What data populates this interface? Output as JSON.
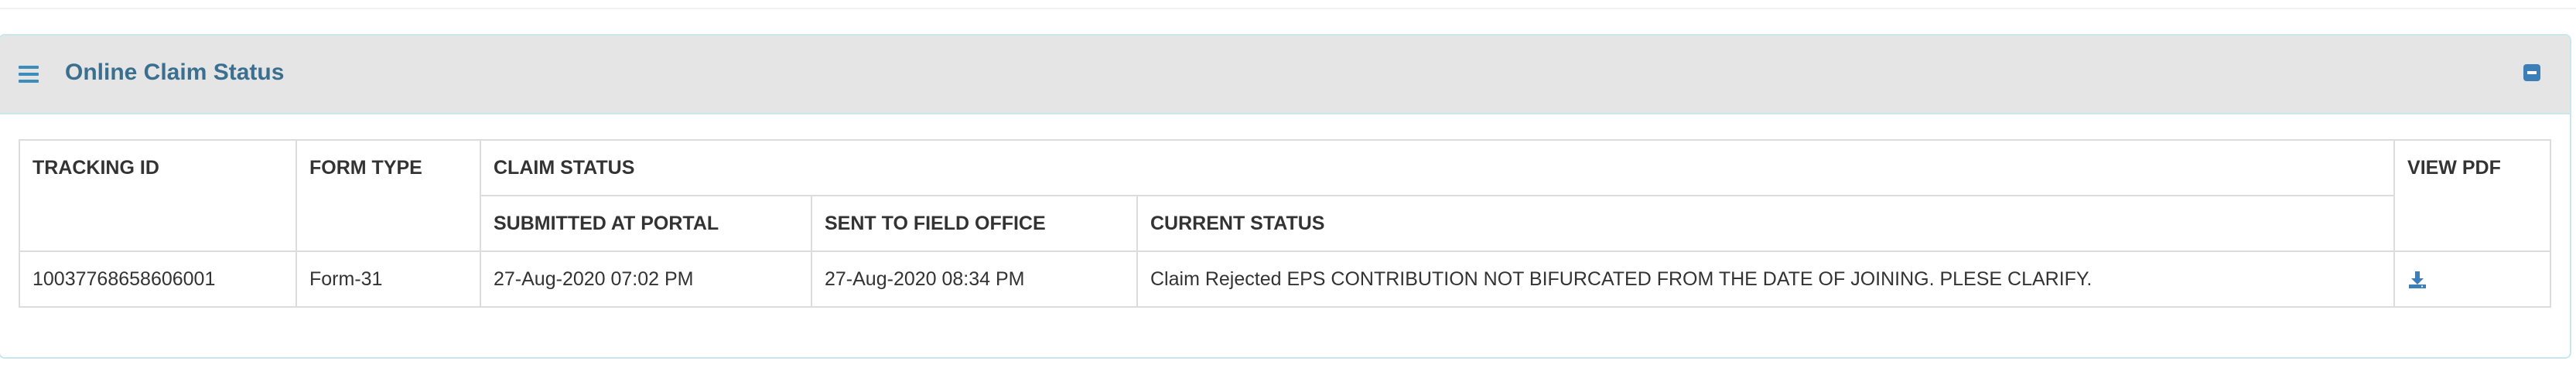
{
  "panel": {
    "title": "Online Claim Status",
    "menu_icon": "hamburger-icon",
    "collapse_icon": "minus-square-icon"
  },
  "table": {
    "headers": {
      "tracking_id": "TRACKING ID",
      "form_type": "FORM TYPE",
      "claim_status": "CLAIM STATUS",
      "submitted_at_portal": "SUBMITTED AT PORTAL",
      "sent_to_field_office": "SENT TO FIELD OFFICE",
      "current_status": "CURRENT STATUS",
      "view_pdf": "VIEW PDF"
    },
    "rows": [
      {
        "tracking_id": "10037768658606001",
        "form_type": "Form-31",
        "submitted_at_portal": "27-Aug-2020 07:02 PM",
        "sent_to_field_office": "27-Aug-2020 08:34 PM",
        "current_status": "Claim Rejected EPS CONTRIBUTION NOT BIFURCATED FROM THE DATE OF JOINING. PLESE CLARIFY.",
        "view_pdf_icon": "download-icon"
      }
    ]
  },
  "colors": {
    "accent": "#3c8dbc",
    "title": "#3a6f8f",
    "header_bg": "#e5e5e5",
    "panel_border": "#c9e7ea"
  }
}
